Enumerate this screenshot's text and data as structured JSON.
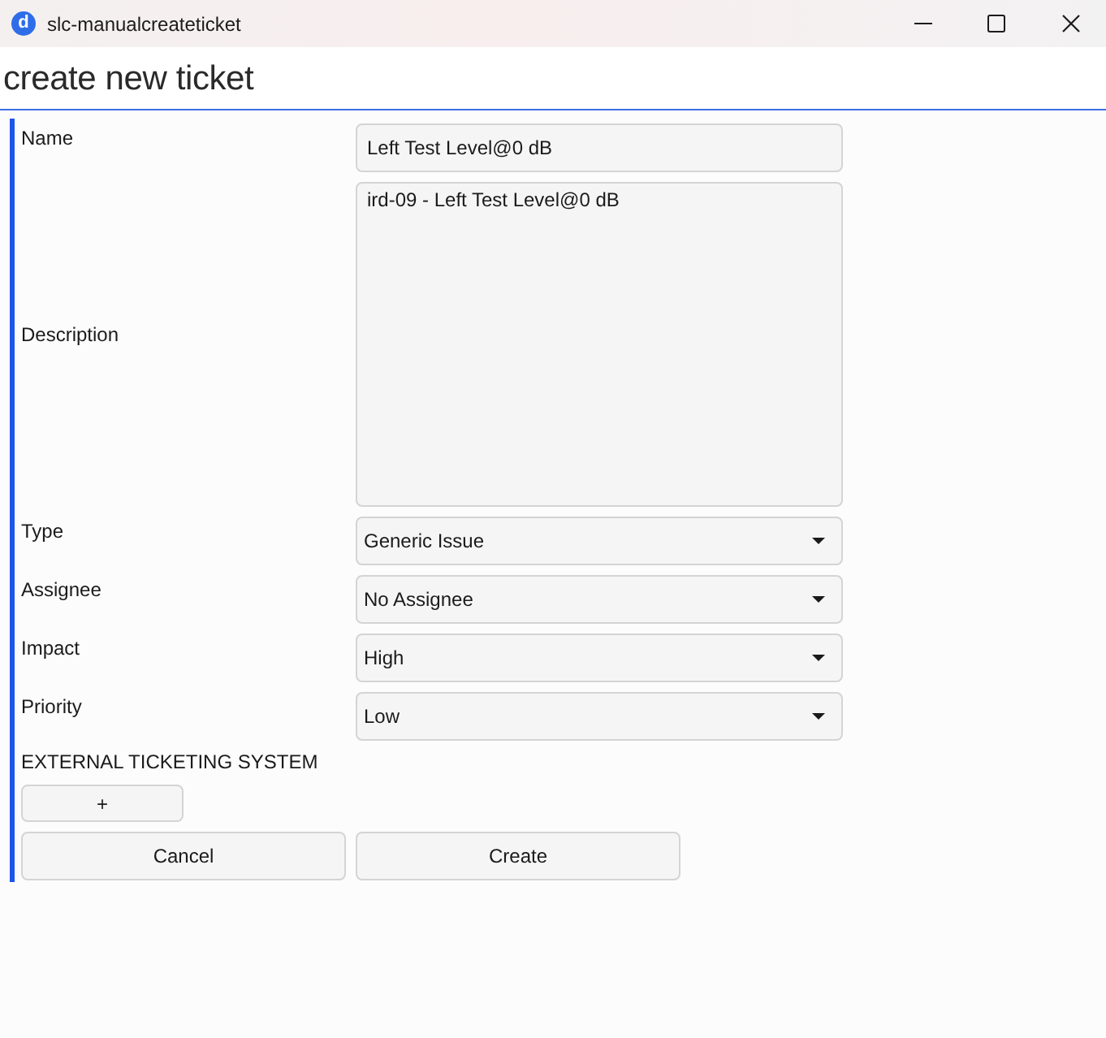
{
  "window": {
    "logo": "d",
    "title": "slc-manualcreateticket"
  },
  "heading": "create new ticket",
  "fields": [
    {
      "kind": "text",
      "label": "Name",
      "value": "Left Test Level@0 dB"
    },
    {
      "kind": "textarea",
      "label": "Description",
      "value": "ird-09 - Left Test Level@0 dB"
    },
    {
      "kind": "dropdown",
      "label": "Type",
      "value": "Generic Issue"
    },
    {
      "kind": "dropdown",
      "label": "Assignee",
      "value": "No Assignee"
    },
    {
      "kind": "dropdown",
      "label": "Impact",
      "value": "High"
    },
    {
      "kind": "dropdown",
      "label": "Priority",
      "value": "Low"
    }
  ],
  "external_ticketing": {
    "title": "EXTERNAL TICKETING SYSTEM",
    "add_button": "+"
  },
  "buttons": [
    {
      "label": "Cancel"
    },
    {
      "label": "Create"
    }
  ]
}
